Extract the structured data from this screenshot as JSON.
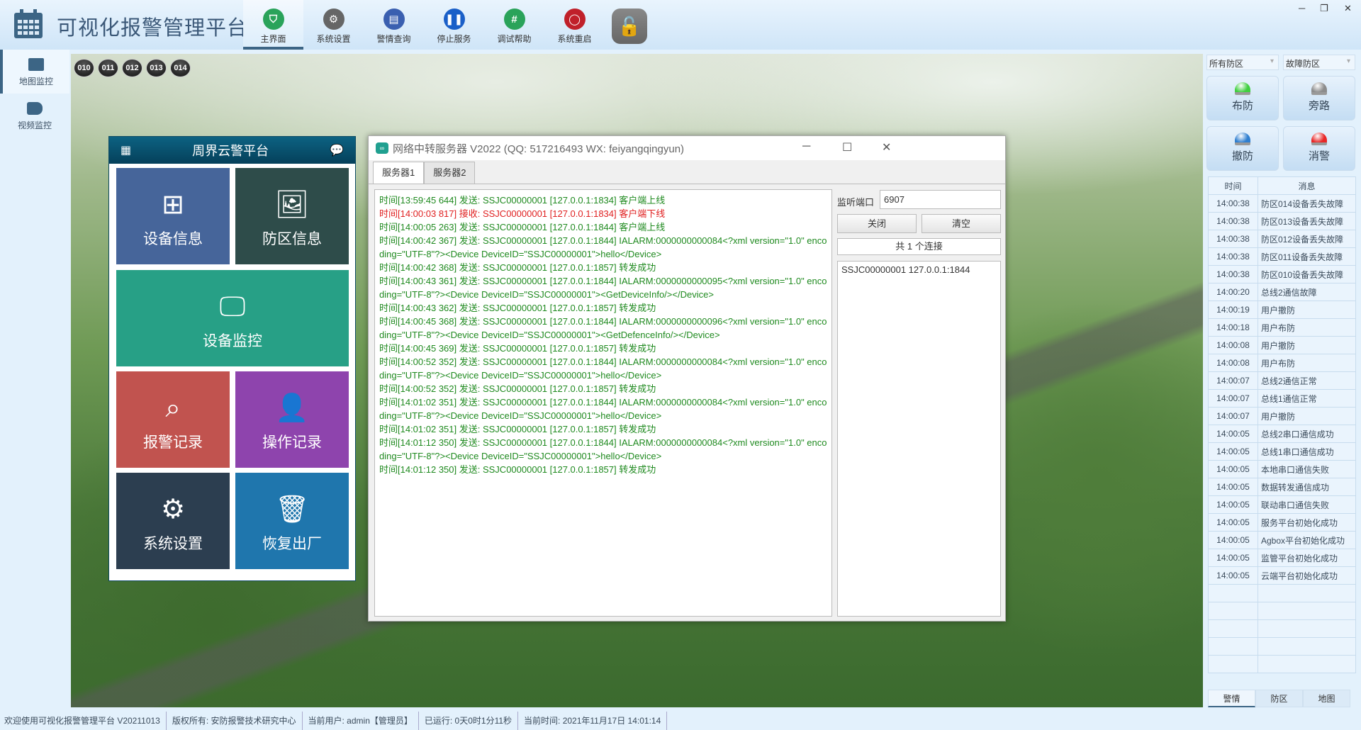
{
  "header": {
    "title": "可视化报警管理平台",
    "nav": [
      {
        "label": "主界面",
        "icon": "shield-icon",
        "color": "#2aa35a"
      },
      {
        "label": "系统设置",
        "icon": "gear-icon",
        "color": "#666666"
      },
      {
        "label": "警情查询",
        "icon": "document-icon",
        "color": "#3a5fb0"
      },
      {
        "label": "停止服务",
        "icon": "pause-icon",
        "color": "#1a5fc8"
      },
      {
        "label": "调试帮助",
        "icon": "hash-chat-icon",
        "color": "#2aa35a"
      },
      {
        "label": "系统重启",
        "icon": "power-icon",
        "color": "#c0202a"
      }
    ],
    "lock_icon": "unlock-icon"
  },
  "sidebar": [
    {
      "label": "地图监控",
      "icon": "image-icon"
    },
    {
      "label": "视频监控",
      "icon": "video-camera-icon"
    }
  ],
  "zones": [
    "010",
    "011",
    "012",
    "013",
    "014"
  ],
  "panel": {
    "title": "周界云警平台",
    "tiles": [
      {
        "label": "设备信息",
        "icon": "sitemap-icon",
        "color": "#46659a"
      },
      {
        "label": "防区信息",
        "icon": "picture-icon",
        "color": "#2e4c4a"
      },
      {
        "label": "设备监控",
        "icon": "monitor-icon",
        "color": "#27a086"
      },
      {
        "label": "报警记录",
        "icon": "search-icon",
        "color": "#c1534f"
      },
      {
        "label": "操作记录",
        "icon": "user-doctor-icon",
        "color": "#8e44ad"
      },
      {
        "label": "系统设置",
        "icon": "gears-icon",
        "color": "#2c3e50"
      },
      {
        "label": "恢复出厂",
        "icon": "trash-icon",
        "color": "#1f76ad"
      }
    ]
  },
  "server": {
    "title": "网络中转服务器 V2022 (QQ: 517216493 WX: feiyangqingyun)",
    "tabs": [
      "服务器1",
      "服务器2"
    ],
    "colors": {
      "send": "#1f8a1f",
      "recv": "#e02020"
    },
    "log": [
      {
        "t": "时间[13:59:45 644] 发送: SSJC00000001 [127.0.0.1:1834] 客户端上线",
        "c": "send"
      },
      {
        "t": "时间[14:00:03 817] 接收: SSJC00000001 [127.0.0.1:1834] 客户端下线",
        "c": "recv"
      },
      {
        "t": "时间[14:00:05 263] 发送: SSJC00000001 [127.0.0.1:1844] 客户端上线",
        "c": "send"
      },
      {
        "t": "时间[14:00:42 367] 发送: SSJC00000001 [127.0.0.1:1844] IALARM:0000000000084<?xml version=\"1.0\" encoding=\"UTF-8\"?><Device DeviceID=\"SSJC00000001\">hello</Device>",
        "c": "send"
      },
      {
        "t": "时间[14:00:42 368] 发送: SSJC00000001 [127.0.0.1:1857] 转发成功",
        "c": "send"
      },
      {
        "t": "时间[14:00:43 361] 发送: SSJC00000001 [127.0.0.1:1844] IALARM:0000000000095<?xml version=\"1.0\" encoding=\"UTF-8\"?><Device DeviceID=\"SSJC00000001\"><GetDeviceInfo/></Device>",
        "c": "send"
      },
      {
        "t": "时间[14:00:43 362] 发送: SSJC00000001 [127.0.0.1:1857] 转发成功",
        "c": "send"
      },
      {
        "t": "时间[14:00:45 368] 发送: SSJC00000001 [127.0.0.1:1844] IALARM:0000000000096<?xml version=\"1.0\" encoding=\"UTF-8\"?><Device DeviceID=\"SSJC00000001\"><GetDefenceInfo/></Device>",
        "c": "send"
      },
      {
        "t": "时间[14:00:45 369] 发送: SSJC00000001 [127.0.0.1:1857] 转发成功",
        "c": "send"
      },
      {
        "t": "时间[14:00:52 352] 发送: SSJC00000001 [127.0.0.1:1844] IALARM:0000000000084<?xml version=\"1.0\" encoding=\"UTF-8\"?><Device DeviceID=\"SSJC00000001\">hello</Device>",
        "c": "send"
      },
      {
        "t": "时间[14:00:52 352] 发送: SSJC00000001 [127.0.0.1:1857] 转发成功",
        "c": "send"
      },
      {
        "t": "时间[14:01:02 351] 发送: SSJC00000001 [127.0.0.1:1844] IALARM:0000000000084<?xml version=\"1.0\" encoding=\"UTF-8\"?><Device DeviceID=\"SSJC00000001\">hello</Device>",
        "c": "send"
      },
      {
        "t": "时间[14:01:02 351] 发送: SSJC00000001 [127.0.0.1:1857] 转发成功",
        "c": "send"
      },
      {
        "t": "时间[14:01:12 350] 发送: SSJC00000001 [127.0.0.1:1844] IALARM:0000000000084<?xml version=\"1.0\" encoding=\"UTF-8\"?><Device DeviceID=\"SSJC00000001\">hello</Device>",
        "c": "send"
      },
      {
        "t": "时间[14:01:12 350] 发送: SSJC00000001 [127.0.0.1:1857] 转发成功",
        "c": "send"
      }
    ],
    "port_label": "监听端口",
    "port_value": "6907",
    "close_label": "关闭",
    "clear_label": "清空",
    "count": "共 1 个连接",
    "connections": [
      "SSJC00000001 127.0.0.1:1844"
    ]
  },
  "right": {
    "zone_select": "所有防区",
    "fault_select": "故障防区",
    "actions": [
      {
        "label": "布防",
        "color": "#3fcf3f"
      },
      {
        "label": "旁路",
        "color": "#8c8c8c"
      },
      {
        "label": "撤防",
        "color": "#2f7fd0"
      },
      {
        "label": "消警",
        "color": "#e82828"
      }
    ],
    "table_headers": [
      "时间",
      "消息"
    ],
    "rows": [
      [
        "14:00:38",
        "防区014设备丢失故障"
      ],
      [
        "14:00:38",
        "防区013设备丢失故障"
      ],
      [
        "14:00:38",
        "防区012设备丢失故障"
      ],
      [
        "14:00:38",
        "防区011设备丢失故障"
      ],
      [
        "14:00:38",
        "防区010设备丢失故障"
      ],
      [
        "14:00:20",
        "总线2通信故障"
      ],
      [
        "14:00:19",
        "用户撤防"
      ],
      [
        "14:00:18",
        "用户布防"
      ],
      [
        "14:00:08",
        "用户撤防"
      ],
      [
        "14:00:08",
        "用户布防"
      ],
      [
        "14:00:07",
        "总线2通信正常"
      ],
      [
        "14:00:07",
        "总线1通信正常"
      ],
      [
        "14:00:07",
        "用户撤防"
      ],
      [
        "14:00:05",
        "总线2串口通信成功"
      ],
      [
        "14:00:05",
        "总线1串口通信成功"
      ],
      [
        "14:00:05",
        "本地串口通信失败"
      ],
      [
        "14:00:05",
        "数据转发通信成功"
      ],
      [
        "14:00:05",
        "联动串口通信失败"
      ],
      [
        "14:00:05",
        "服务平台初始化成功"
      ],
      [
        "14:00:05",
        "Agbox平台初始化成功"
      ],
      [
        "14:00:05",
        "监管平台初始化成功"
      ],
      [
        "14:00:05",
        "云端平台初始化成功"
      ]
    ],
    "tabs": [
      "警情",
      "防区",
      "地图"
    ]
  },
  "status": [
    "欢迎使用可视化报警管理平台 V20211013",
    "版权所有: 安防报警技术研究中心",
    "当前用户: admin【管理员】",
    "已运行: 0天0时1分11秒",
    "当前时间: 2021年11月17日 14:01:14"
  ]
}
